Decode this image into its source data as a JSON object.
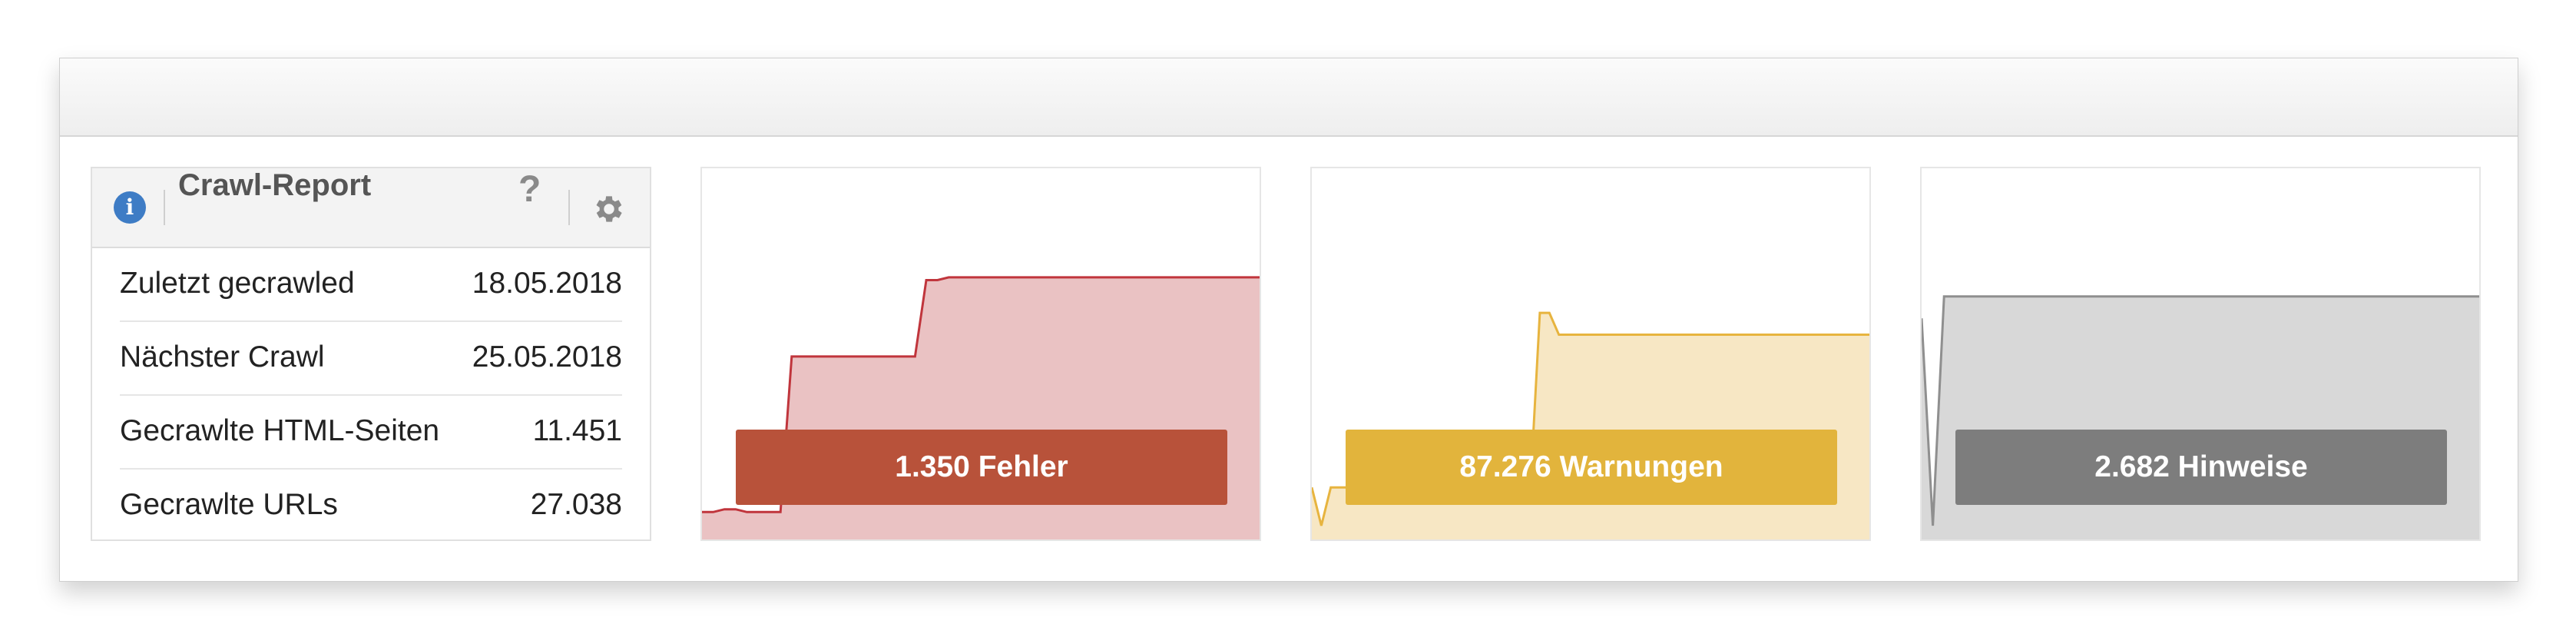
{
  "report": {
    "title": "Crawl-Report",
    "info_icon": "info-icon",
    "help_icon": "question-icon",
    "settings_icon": "gear-icon",
    "rows": [
      {
        "label": "Zuletzt gecrawled",
        "value": "18.05.2018"
      },
      {
        "label": "Nächster Crawl",
        "value": "25.05.2018"
      },
      {
        "label": "Gecrawlte HTML-Seiten",
        "value": "11.451"
      },
      {
        "label": "Gecrawlte URLs",
        "value": "27.038"
      }
    ]
  },
  "cards": [
    {
      "label": "1.350 Fehler",
      "color": "#b8523a",
      "line": "#c0353c",
      "fill": "#eac2c3"
    },
    {
      "label": "87.276 Warnungen",
      "color": "#e2b43c",
      "line": "#e7b43f",
      "fill": "#f7e7c4"
    },
    {
      "label": "2.682 Hinweise",
      "color": "#7d7d7d",
      "line": "#8f8f8f",
      "fill": "#d8d8d8"
    }
  ],
  "chart_data": [
    {
      "type": "area",
      "series": [
        {
          "values": [
            5,
            5,
            6,
            6,
            5,
            5,
            5,
            5,
            62,
            62,
            62,
            62,
            62,
            62,
            62,
            62,
            62,
            62,
            62,
            62,
            90,
            90,
            91,
            91,
            91,
            91,
            91,
            91,
            91,
            91,
            91,
            91,
            91,
            91,
            91,
            91,
            91,
            91,
            91,
            91,
            91,
            91,
            91,
            91,
            91,
            91,
            91,
            91,
            91,
            91,
            91
          ]
        }
      ]
    },
    {
      "type": "area",
      "series": [
        {
          "values": [
            14,
            0,
            14,
            14,
            14,
            14,
            14,
            14,
            14,
            14,
            14,
            14,
            14,
            14,
            14,
            14,
            14,
            14,
            14,
            14,
            14,
            14,
            14,
            14,
            78,
            78,
            70,
            70,
            70,
            70,
            70,
            70,
            70,
            70,
            70,
            70,
            70,
            70,
            70,
            70,
            70,
            70,
            70,
            70,
            70,
            70,
            70,
            70,
            70,
            70,
            70,
            70,
            70,
            70,
            70,
            70,
            70,
            70,
            70,
            70
          ]
        }
      ]
    },
    {
      "type": "area",
      "series": [
        {
          "values": [
            76,
            0,
            84,
            84,
            84,
            84,
            84,
            84,
            84,
            84,
            84,
            84,
            84,
            84,
            84,
            84,
            84,
            84,
            84,
            84,
            84,
            84,
            84,
            84,
            84,
            84,
            84,
            84,
            84,
            84,
            84,
            84,
            84,
            84,
            84,
            84,
            84,
            84,
            84,
            84,
            84,
            84,
            84,
            84,
            84,
            84,
            84,
            84,
            84,
            84,
            84
          ]
        }
      ]
    }
  ]
}
